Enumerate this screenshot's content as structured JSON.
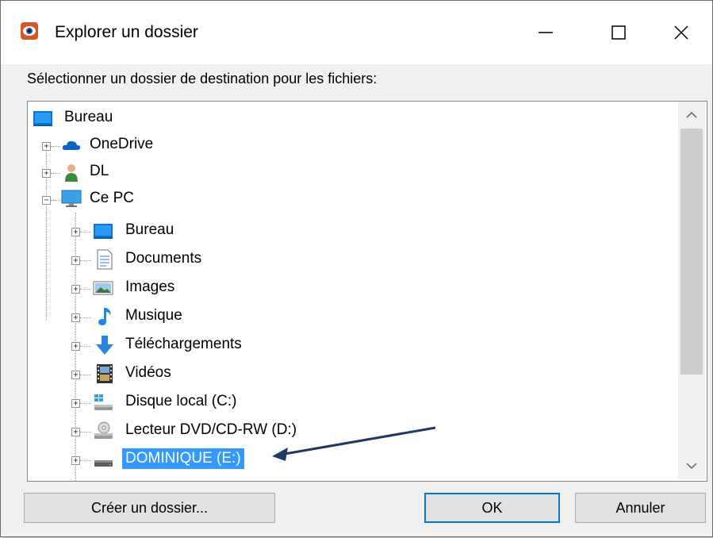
{
  "window": {
    "title": "Explorer un dossier",
    "controls": {
      "minimize": "—",
      "maximize": "☐",
      "close": "✕"
    }
  },
  "prompt": "Sélectionner un dossier de destination pour les fichiers:",
  "tree": {
    "items": [
      {
        "label": "Bureau",
        "icon": "desktop-icon",
        "level": 0,
        "expander": ""
      },
      {
        "label": "OneDrive",
        "icon": "onedrive-cloud-icon",
        "level": 1,
        "expander": "+"
      },
      {
        "label": "DL",
        "icon": "user-icon",
        "level": 1,
        "expander": "+"
      },
      {
        "label": "Ce PC",
        "icon": "computer-icon",
        "level": 1,
        "expander": "−"
      },
      {
        "label": "Bureau",
        "icon": "desktop-icon",
        "level": 2,
        "expander": "+"
      },
      {
        "label": "Documents",
        "icon": "documents-icon",
        "level": 2,
        "expander": "+"
      },
      {
        "label": "Images",
        "icon": "images-icon",
        "level": 2,
        "expander": "+"
      },
      {
        "label": "Musique",
        "icon": "music-note-icon",
        "level": 2,
        "expander": "+"
      },
      {
        "label": "Téléchargements",
        "icon": "download-arrow-icon",
        "level": 2,
        "expander": "+"
      },
      {
        "label": "Vidéos",
        "icon": "film-icon",
        "level": 2,
        "expander": "+"
      },
      {
        "label": "Disque local (C:)",
        "icon": "windows-drive-icon",
        "level": 2,
        "expander": "+"
      },
      {
        "label": "Lecteur DVD/CD-RW (D:)",
        "icon": "dvd-drive-icon",
        "level": 2,
        "expander": "+"
      },
      {
        "label": "DOMINIQUE (E:)",
        "icon": "usb-drive-icon",
        "level": 2,
        "expander": "+",
        "selected": true
      }
    ]
  },
  "buttons": {
    "new_folder": "Créer un dossier...",
    "ok": "OK",
    "cancel": "Annuler"
  },
  "colors": {
    "selection": "#3399ff",
    "annotation_arrow": "#1f3864",
    "ok_border": "#0078d7"
  }
}
